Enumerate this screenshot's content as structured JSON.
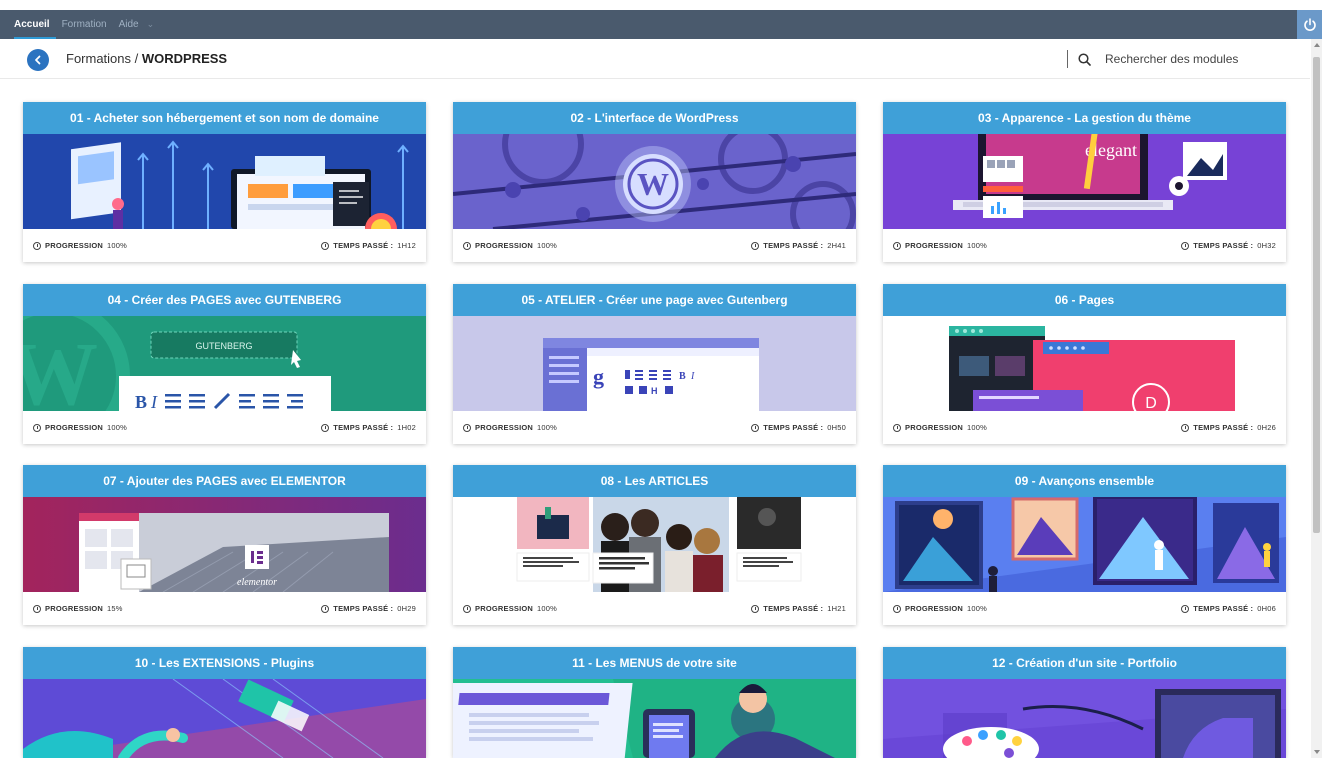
{
  "topnav": {
    "items": [
      {
        "label": "Accueil",
        "active": true
      },
      {
        "label": "Formation",
        "active": false
      },
      {
        "label": "Aide",
        "active": false
      }
    ],
    "dropdown_icon": "chevron-down-icon",
    "power_icon": "power-icon"
  },
  "header": {
    "breadcrumb_prefix": "Formations / ",
    "breadcrumb_current": "WORDPRESS",
    "back_icon": "chevron-left-icon",
    "search_placeholder": "Rechercher des modules",
    "search_icon": "search-icon"
  },
  "labels": {
    "progression": "PROGRESSION",
    "temps": "TEMPS PASSÉ :"
  },
  "colors": {
    "topbar": "#4a5a6d",
    "accent": "#3fa0d8",
    "back_button": "#2b73c0",
    "power_button": "#6b99c9"
  },
  "modules": [
    {
      "title": "01 - Acheter son hébergement et son nom de domaine",
      "progression": "100%",
      "temps": "1H12"
    },
    {
      "title": "02 - L'interface de WordPress",
      "progression": "100%",
      "temps": "2H41"
    },
    {
      "title": "03 - Apparence - La gestion du thème",
      "progression": "100%",
      "temps": "0H32",
      "image_text": "elegant"
    },
    {
      "title": "04 - Créer des PAGES avec GUTENBERG",
      "progression": "100%",
      "temps": "1H02",
      "image_text": "GUTENBERG"
    },
    {
      "title": "05 - ATELIER - Créer une page avec Gutenberg",
      "progression": "100%",
      "temps": "0H50"
    },
    {
      "title": "06 - Pages",
      "progression": "100%",
      "temps": "0H26"
    },
    {
      "title": "07 - Ajouter des PAGES avec ELEMENTOR",
      "progression": "15%",
      "temps": "0H29",
      "image_text": "elementor"
    },
    {
      "title": "08 - Les ARTICLES",
      "progression": "100%",
      "temps": "1H21"
    },
    {
      "title": "09 - Avançons ensemble",
      "progression": "100%",
      "temps": "0H06"
    },
    {
      "title": "10 - Les EXTENSIONS - Plugins"
    },
    {
      "title": "11 - Les MENUS de votre site"
    },
    {
      "title": "12 - Création d'un site - Portfolio"
    }
  ]
}
